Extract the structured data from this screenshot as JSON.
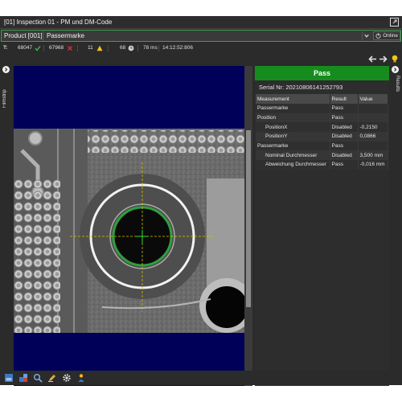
{
  "window": {
    "title": "[01] Inspection 01 - PM und DM-Code"
  },
  "product": {
    "label": "Product [001]",
    "name": "Passermarke",
    "online_label": "Online"
  },
  "stats": {
    "t_label": "T:",
    "total": "68047",
    "passed": "67968",
    "failed": "11",
    "warnings": "68",
    "duration": "78 ms",
    "time": "14:12:52:806"
  },
  "rails": {
    "filmstrip_label": "Filmstrip",
    "results_label": "Results"
  },
  "results": {
    "status": "Pass",
    "serial": "Serial Nr: 20210806141252793",
    "columns": [
      "Measurement",
      "Result",
      "Value"
    ],
    "rows": [
      {
        "measurement": "Passermarke",
        "result": "Pass",
        "value": ""
      },
      {
        "measurement": "Position",
        "result": "Pass",
        "value": ""
      },
      {
        "measurement": "PositionX",
        "result": "Disabled",
        "value": "-0,2150"
      },
      {
        "measurement": "PositionY",
        "result": "Disabled",
        "value": "0,0866"
      },
      {
        "measurement": "Passermarke",
        "result": "Pass",
        "value": ""
      },
      {
        "measurement": "Nominal Durchmesser",
        "result": "Disabled",
        "value": "3,500 mm"
      },
      {
        "measurement": "Abweichung Durchmesser",
        "result": "Pass",
        "value": "-0,016 mm"
      }
    ]
  },
  "colors": {
    "accent_green": "#3f9f4a",
    "pass_green": "#168c1f",
    "fail_red": "#e03030",
    "warn_yellow": "#f0c020",
    "viewer_bg": "#000058"
  },
  "icons": {
    "popout": "popout-icon",
    "power": "power-icon",
    "check": "check-icon",
    "cross": "cross-icon",
    "warning": "warning-icon",
    "clock": "clock-icon",
    "prev": "arrow-left-icon",
    "next": "arrow-right-icon",
    "bulb": "bulb-icon"
  },
  "toolbar": {
    "items": [
      "image-view-icon",
      "layout-icon",
      "search-icon",
      "edit-icon",
      "settings-icon",
      "user-icon"
    ]
  }
}
